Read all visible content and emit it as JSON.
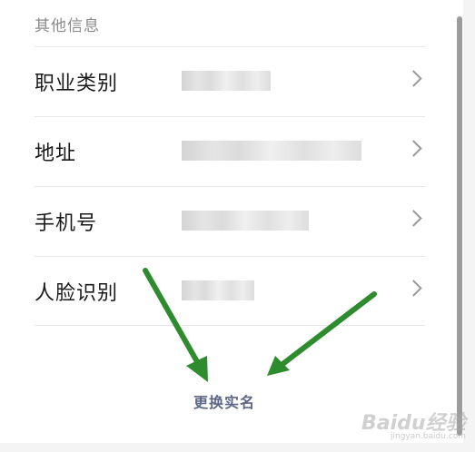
{
  "section": {
    "title": "其他信息"
  },
  "rows": [
    {
      "label": "职业类别"
    },
    {
      "label": "地址"
    },
    {
      "label": "手机号"
    },
    {
      "label": "人脸识别"
    }
  ],
  "footer": {
    "change_name_label": "更换实名"
  },
  "annotation": {
    "arrow_color": "#2e8b2e"
  },
  "watermark": {
    "text": "Baidu经验",
    "sub": "jingyan.baidu.com"
  }
}
